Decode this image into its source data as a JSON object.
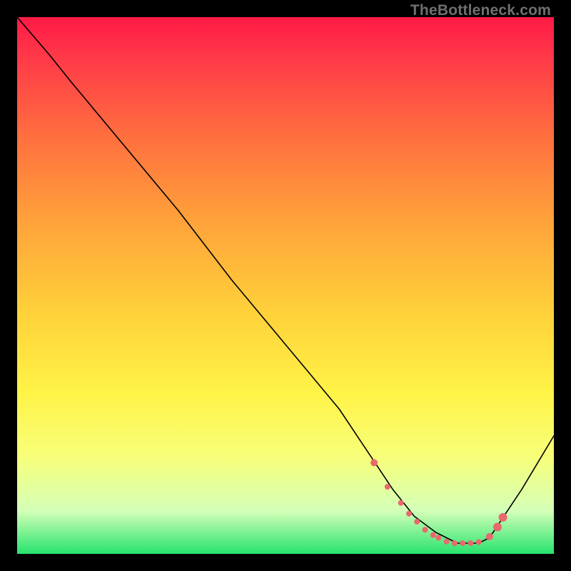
{
  "watermark": "TheBottleneck.com",
  "chart_data": {
    "type": "line",
    "title": "",
    "xlabel": "",
    "ylabel": "",
    "xlim": [
      0,
      100
    ],
    "ylim": [
      0,
      100
    ],
    "series": [
      {
        "name": "bottleneck-curve",
        "x": [
          0,
          6,
          10,
          20,
          30,
          40,
          50,
          60,
          66,
          70,
          74,
          78,
          82,
          86,
          88,
          90,
          94,
          100
        ],
        "y": [
          100,
          93,
          88,
          76,
          64,
          51,
          39,
          27,
          18,
          12,
          7,
          4,
          2,
          2,
          3,
          6,
          12,
          22
        ]
      }
    ],
    "markers": {
      "name": "highlight-dots",
      "x": [
        66.5,
        69,
        71.5,
        73,
        74.5,
        76,
        77.5,
        78.5,
        80,
        81.5,
        83,
        84.5,
        86,
        88,
        89.5,
        90.5
      ],
      "y": [
        17.0,
        12.5,
        9.5,
        7.5,
        6.0,
        4.5,
        3.5,
        3.0,
        2.3,
        2.0,
        2.0,
        2.0,
        2.2,
        3.2,
        5.0,
        6.8
      ],
      "r": [
        5,
        4,
        4,
        4,
        4,
        4,
        4,
        4,
        4,
        4,
        4,
        4,
        4,
        5,
        6,
        6
      ]
    }
  }
}
